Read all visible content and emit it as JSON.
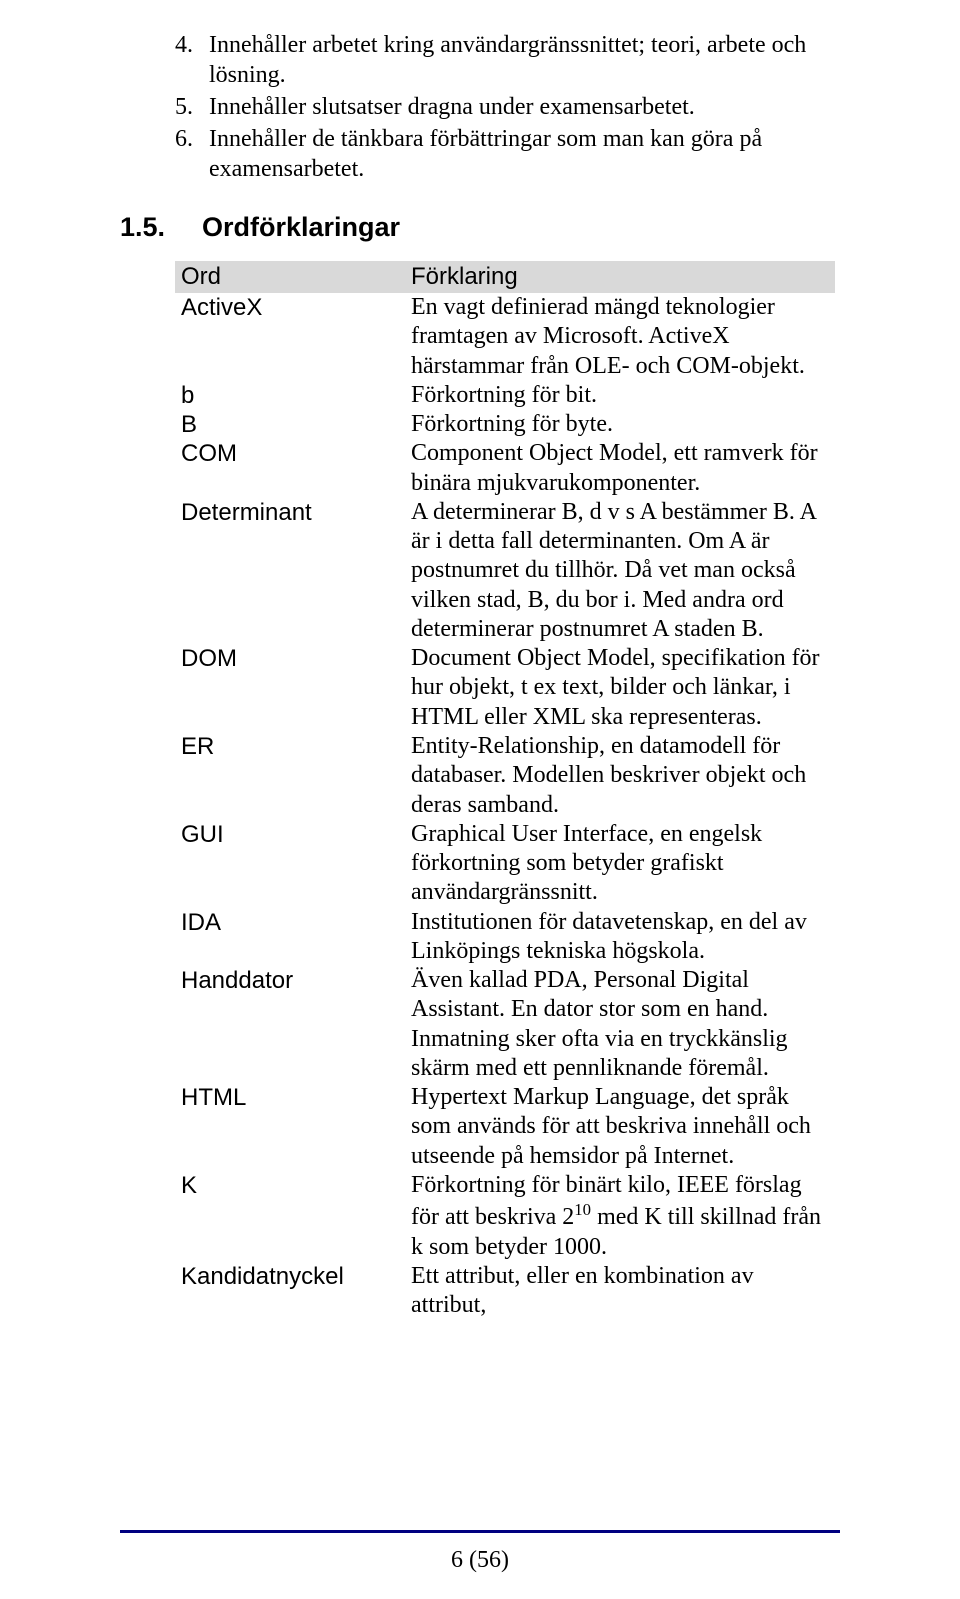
{
  "list_items": [
    {
      "num": "4.",
      "text": "Innehåller arbetet kring användargränssnittet; teori, arbete och lösning."
    },
    {
      "num": "5.",
      "text": "Innehåller slutsatser dragna under examensarbetet."
    },
    {
      "num": "6.",
      "text": "Innehåller de tänkbara förbättringar som man kan göra på examensarbetet."
    }
  ],
  "section": {
    "num": "1.5.",
    "title": "Ordförklaringar"
  },
  "table": {
    "headers": {
      "term": "Ord",
      "def": "Förklaring"
    },
    "rows": [
      {
        "term": "ActiveX",
        "def": "En vagt definierad mängd teknologier framtagen av Microsoft. ActiveX härstammar från OLE- och COM-objekt."
      },
      {
        "term": "b",
        "def": "Förkortning för bit."
      },
      {
        "term": "B",
        "def": "Förkortning för byte."
      },
      {
        "term": "COM",
        "def": "Component Object Model, ett ramverk för binära mjukvarukomponenter."
      },
      {
        "term": "Determinant",
        "def": "A determinerar B, d v s A bestämmer B. A är i detta fall determinanten. Om A är postnumret du tillhör. Då vet man också vilken stad, B, du bor i. Med andra ord determinerar postnumret A staden B."
      },
      {
        "term": "DOM",
        "def": "Document Object Model, specifikation för hur objekt, t ex text, bilder och länkar, i HTML eller XML ska representeras."
      },
      {
        "term": "ER",
        "def": "Entity-Relationship, en datamodell för databaser. Modellen beskriver objekt och deras samband."
      },
      {
        "term": "GUI",
        "def": "Graphical User Interface, en engelsk förkortning som betyder grafiskt användargränssnitt."
      },
      {
        "term": "IDA",
        "def": "Institutionen för datavetenskap, en del av Linköpings tekniska högskola."
      },
      {
        "term": "Handdator",
        "def": "Även kallad PDA, Personal Digital Assistant. En dator stor som en hand. Inmatning sker ofta via en tryckkänslig skärm med ett pennliknande föremål."
      },
      {
        "term": "HTML",
        "def": "Hypertext Markup Language, det språk som används för att beskriva innehåll och utseende på hemsidor på Internet."
      },
      {
        "term": "K",
        "def_html": "Förkortning för binärt kilo, IEEE förslag för att beskriva 2<span class='sup'>10</span> med K till skillnad från k som betyder 1000."
      },
      {
        "term": "Kandidatnyckel",
        "def": "Ett attribut, eller en kombination av attribut,"
      }
    ]
  },
  "page_number": "6 (56)"
}
